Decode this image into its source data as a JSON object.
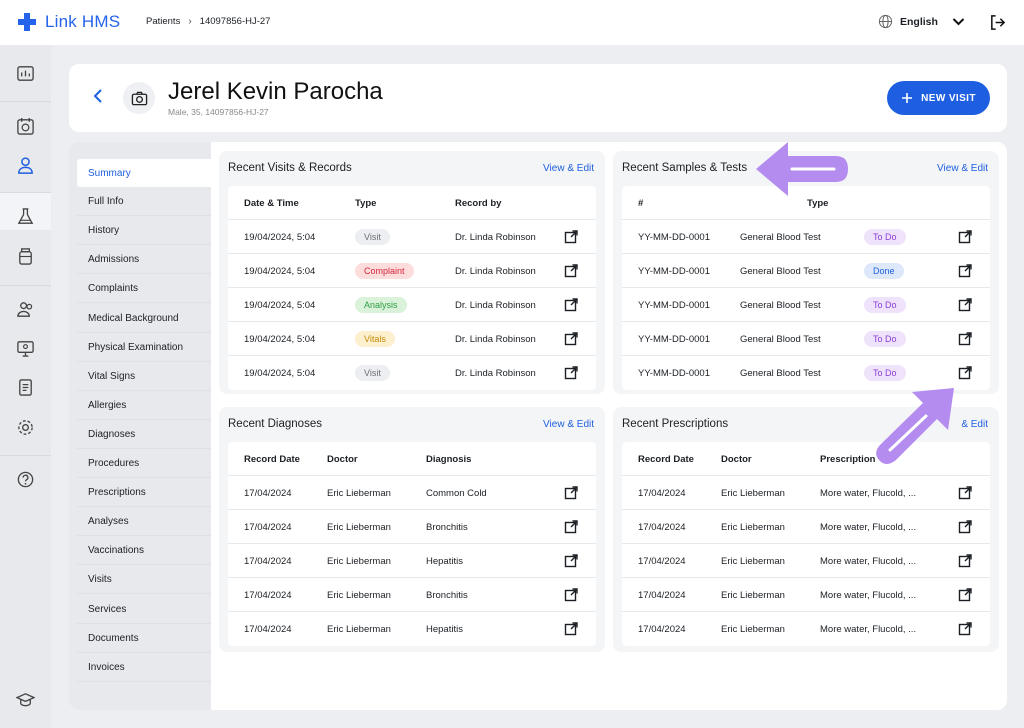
{
  "app": {
    "name": "Link HMS"
  },
  "breadcrumb": {
    "root": "Patients",
    "current": "14097856-HJ-27"
  },
  "language": {
    "label": "English"
  },
  "colors": {
    "accent": "#1d5fe0",
    "arrow": "#b48cf0"
  },
  "patient": {
    "name": "Jerel Kevin Parocha",
    "meta": "Male, 35, 14097856-HJ-27"
  },
  "header": {
    "new_visit_label": "NEW VISIT"
  },
  "subnav": {
    "items": [
      "Summary",
      "Full Info",
      "History",
      "Admissions",
      "Complaints",
      "Medical Background",
      "Physical Examination",
      "Vital Signs",
      "Allergies",
      "Diagnoses",
      "Procedures",
      "Prescriptions",
      "Analyses",
      "Vaccinations",
      "Visits",
      "Services",
      "Documents",
      "Invoices"
    ],
    "active": "Summary"
  },
  "visits": {
    "title": "Recent Visits & Records",
    "link": "View & Edit",
    "columns": [
      "Date & Time",
      "Type",
      "Record by"
    ],
    "rows": [
      {
        "date": "19/04/2024, 5:04",
        "type": "Visit",
        "by": "Dr. Linda Robinson"
      },
      {
        "date": "19/04/2024, 5:04",
        "type": "Complaint",
        "by": "Dr. Linda Robinson"
      },
      {
        "date": "19/04/2024, 5:04",
        "type": "Analysis",
        "by": "Dr. Linda Robinson"
      },
      {
        "date": "19/04/2024, 5:04",
        "type": "Vitals",
        "by": "Dr. Linda Robinson"
      },
      {
        "date": "19/04/2024, 5:04",
        "type": "Visit",
        "by": "Dr. Linda Robinson"
      }
    ]
  },
  "samples": {
    "title": "Recent Samples & Tests",
    "link": "View & Edit",
    "columns": [
      "#",
      "Type"
    ],
    "rows": [
      {
        "id": "YY-MM-DD-0001",
        "type": "General Blood Test",
        "status": "To Do"
      },
      {
        "id": "YY-MM-DD-0001",
        "type": "General Blood Test",
        "status": "Done"
      },
      {
        "id": "YY-MM-DD-0001",
        "type": "General Blood Test",
        "status": "To Do"
      },
      {
        "id": "YY-MM-DD-0001",
        "type": "General Blood Test",
        "status": "To Do"
      },
      {
        "id": "YY-MM-DD-0001",
        "type": "General Blood Test",
        "status": "To Do"
      }
    ]
  },
  "diagnoses": {
    "title": "Recent Diagnoses",
    "link": "View & Edit",
    "columns": [
      "Record Date",
      "Doctor",
      "Diagnosis"
    ],
    "rows": [
      {
        "date": "17/04/2024",
        "doctor": "Eric Lieberman",
        "value": "Common Cold"
      },
      {
        "date": "17/04/2024",
        "doctor": "Eric Lieberman",
        "value": "Bronchitis"
      },
      {
        "date": "17/04/2024",
        "doctor": "Eric Lieberman",
        "value": "Hepatitis"
      },
      {
        "date": "17/04/2024",
        "doctor": "Eric Lieberman",
        "value": "Bronchitis"
      },
      {
        "date": "17/04/2024",
        "doctor": "Eric Lieberman",
        "value": "Hepatitis"
      }
    ]
  },
  "prescriptions": {
    "title": "Recent Prescriptions",
    "link": "& Edit",
    "columns": [
      "Record Date",
      "Doctor",
      "Prescription"
    ],
    "rows": [
      {
        "date": "17/04/2024",
        "doctor": "Eric Lieberman",
        "value": "More water, Flucold, ..."
      },
      {
        "date": "17/04/2024",
        "doctor": "Eric Lieberman",
        "value": "More water, Flucold, ..."
      },
      {
        "date": "17/04/2024",
        "doctor": "Eric Lieberman",
        "value": "More water, Flucold, ..."
      },
      {
        "date": "17/04/2024",
        "doctor": "Eric Lieberman",
        "value": "More water, Flucold, ..."
      },
      {
        "date": "17/04/2024",
        "doctor": "Eric Lieberman",
        "value": "More water, Flucold, ..."
      }
    ]
  },
  "badge_styles": {
    "Visit": {
      "bg": "#eceef1",
      "fg": "#6b7077"
    },
    "Complaint": {
      "bg": "#fddcdc",
      "fg": "#d7263d"
    },
    "Analysis": {
      "bg": "#d9f2d9",
      "fg": "#2f9e44"
    },
    "Vitals": {
      "bg": "#fdf0cf",
      "fg": "#c58a07"
    },
    "To Do": {
      "bg": "#efe2fb",
      "fg": "#8b3fd6"
    },
    "Done": {
      "bg": "#dde8fb",
      "fg": "#1d5fe0"
    }
  }
}
